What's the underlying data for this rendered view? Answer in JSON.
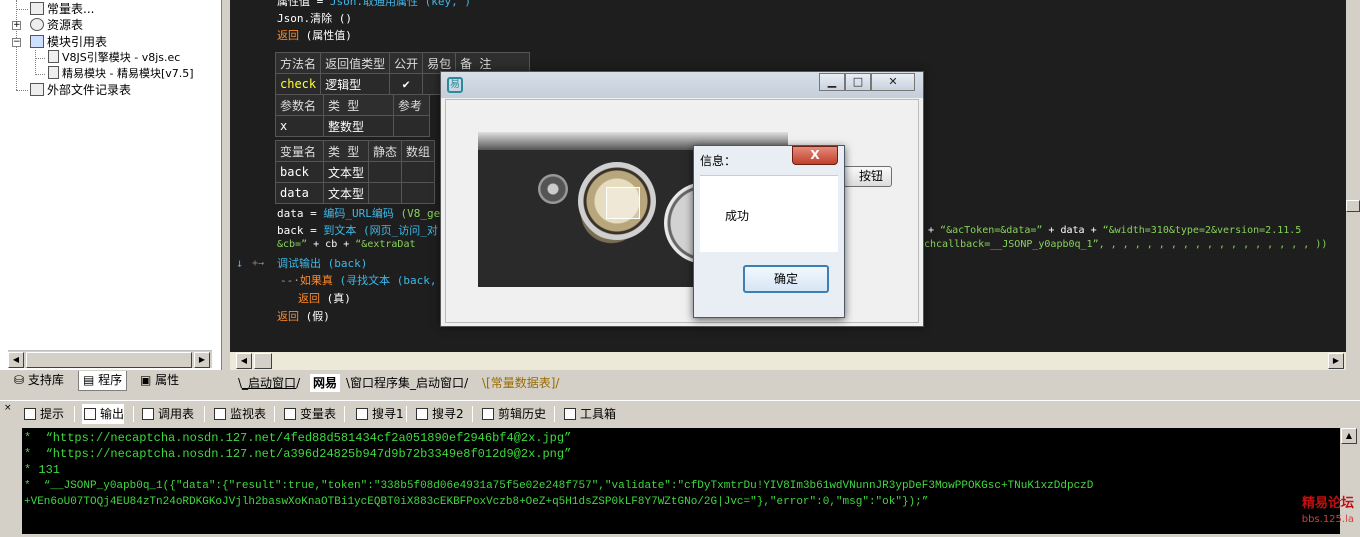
{
  "tree": {
    "items": [
      {
        "label": "常量表..."
      },
      {
        "label": "资源表"
      },
      {
        "label": "模块引用表"
      },
      {
        "label": "V8JS引擎模块 - v8js.ec"
      },
      {
        "label": "精易模块 - 精易模块[v7.5]"
      },
      {
        "label": "外部文件记录表"
      }
    ],
    "tabs": [
      "支持库",
      "程序",
      "属性"
    ]
  },
  "editor": {
    "line1_a": "属性值 = ",
    "line1_b": "Json.取通用属性 (key, )",
    "line2": "Json.清除 ()",
    "line3_kw": "返回",
    "line3_rest": " (属性值)",
    "sub_table": {
      "headers": [
        "方法名",
        "返回值类型",
        "公开",
        "易包",
        "备 注"
      ],
      "row": [
        "check",
        "逻辑型",
        "✔",
        "",
        ""
      ]
    },
    "param_table": {
      "headers": [
        "参数名",
        "类 型",
        "参考"
      ],
      "row": [
        "x",
        "整数型",
        ""
      ]
    },
    "var_table": {
      "headers": [
        "变量名",
        "类 型",
        "静态",
        "数组"
      ],
      "rows": [
        [
          "back",
          "文本型",
          "",
          ""
        ],
        [
          "data",
          "文本型",
          "",
          ""
        ]
      ]
    },
    "l_data": "data = ",
    "l_data_fn": "编码_URL编码",
    "l_data_rest": " (V8_ge",
    "l_back": "back = ",
    "l_back_fn": "到文本",
    "l_back_fn2": " (网页_访问_对",
    "l_back_right_a": "+ ",
    "l_back_right_s1": "“&acToken=&data=”",
    "l_back_right_b": " + data + ",
    "l_back_right_s2": "“&width=310&type=2&version=2.11.5",
    "l_cb": "&cb=”",
    "l_cb_rest": " + cb + ",
    "l_cb_s": "“&extraDat",
    "l_cb_right": "chcallback=__JSONP_y0apb0q_1”, , , , , , , , , , , , , , , , , , ))",
    "l_debug": "调试输出 (back)",
    "l_if_kw": "如果真",
    "l_if_rest": " (寻找文本 (back,",
    "l_ret_true_kw": "返回",
    "l_ret_true": " (真)",
    "l_ret_false_kw": "返回",
    "l_ret_false": " (假)"
  },
  "file_tabs": [
    "_启动窗口",
    "网易",
    "窗口程序集_启动窗口",
    "[常量数据表]"
  ],
  "bottom_tabs": [
    "提示",
    "输出",
    "调用表",
    "监视表",
    "变量表",
    "搜寻1",
    "搜寻2",
    "剪辑历史",
    "工具箱"
  ],
  "output": {
    "lines": [
      "*  “https://necaptcha.nosdn.127.net/4fed88d581434cf2a051890ef2946bf4@2x.jpg”",
      "*  “https://necaptcha.nosdn.127.net/a396d24825b947d9b72b3349e8f012d9@2x.png”",
      "* 131",
      "*  “__JSONP_y0apb0q_1({\"data\":{\"result\":true,\"token\":\"338b5f08d06e4931a75f5e02e248f757\",\"validate\":\"cfDyTxmtrDu!YIV8Im3b61wdVNunnJR3ypDeF3MowPPOKGsc+TNuK1xzDdpczD",
      "+VEn6oU07TOQj4EU84zTn24oRDKGKoJVjlh2baswXoKnaOTBi1ycEQBT0iX883cEKBFPoxVczb8+OeZ+q5H1dsZSP0kLF8Y7WZtGNo/2G|Jvc=\"},\"error\":0,\"msg\":\"ok\"});”"
    ]
  },
  "app_window": {
    "button": "按钮"
  },
  "message_box": {
    "title": "信息：",
    "text": "成功",
    "ok": "确定",
    "close": "X"
  },
  "watermark": {
    "line1": "精易论坛",
    "line2": "bbs.125.la"
  }
}
